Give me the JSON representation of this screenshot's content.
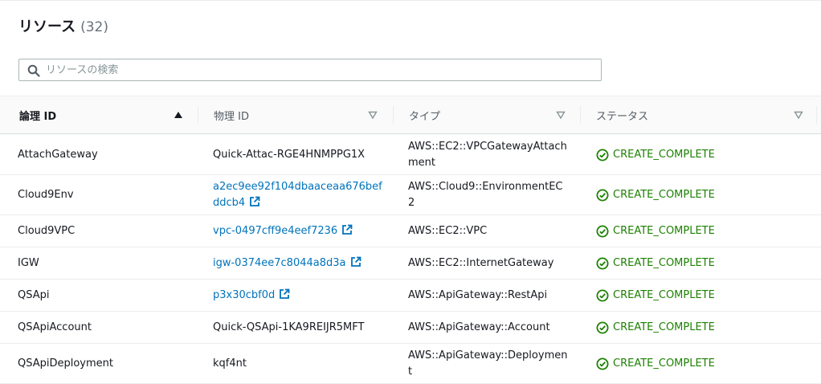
{
  "header": {
    "title": "リソース",
    "count": "(32)"
  },
  "search": {
    "placeholder": "リソースの検索",
    "value": ""
  },
  "columns": {
    "logical_id": "論理 ID",
    "physical_id": "物理 ID",
    "type": "タイプ",
    "status": "ステータス"
  },
  "rows": [
    {
      "logical_id": "AttachGateway",
      "physical_id": "Quick-Attac-RGE4HNMPPG1X",
      "physical_link": false,
      "type": "AWS::EC2::VPCGatewayAttachment",
      "status": "CREATE_COMPLETE"
    },
    {
      "logical_id": "Cloud9Env",
      "physical_id": "a2ec9ee92f104dbaaceaa676befddcb4",
      "physical_link": true,
      "type": "AWS::Cloud9::EnvironmentEC2",
      "status": "CREATE_COMPLETE"
    },
    {
      "logical_id": "Cloud9VPC",
      "physical_id": "vpc-0497cff9e4eef7236",
      "physical_link": true,
      "type": "AWS::EC2::VPC",
      "status": "CREATE_COMPLETE"
    },
    {
      "logical_id": "IGW",
      "physical_id": "igw-0374ee7c8044a8d3a",
      "physical_link": true,
      "type": "AWS::EC2::InternetGateway",
      "status": "CREATE_COMPLETE"
    },
    {
      "logical_id": "QSApi",
      "physical_id": "p3x30cbf0d",
      "physical_link": true,
      "type": "AWS::ApiGateway::RestApi",
      "status": "CREATE_COMPLETE"
    },
    {
      "logical_id": "QSApiAccount",
      "physical_id": "Quick-QSApi-1KA9REIJR5MFT",
      "physical_link": false,
      "type": "AWS::ApiGateway::Account",
      "status": "CREATE_COMPLETE"
    },
    {
      "logical_id": "QSApiDeployment",
      "physical_id": "kqf4nt",
      "physical_link": false,
      "type": "AWS::ApiGateway::Deployment",
      "status": "CREATE_COMPLETE"
    }
  ],
  "colors": {
    "link": "#0073bb",
    "success": "#1d8102",
    "border": "#eaeded"
  },
  "icons": {
    "search": "search-icon",
    "sort_asc": "sort-ascending-icon",
    "sort_none": "sort-caret-icon",
    "external": "external-link-icon",
    "status": "check-circle-icon"
  }
}
